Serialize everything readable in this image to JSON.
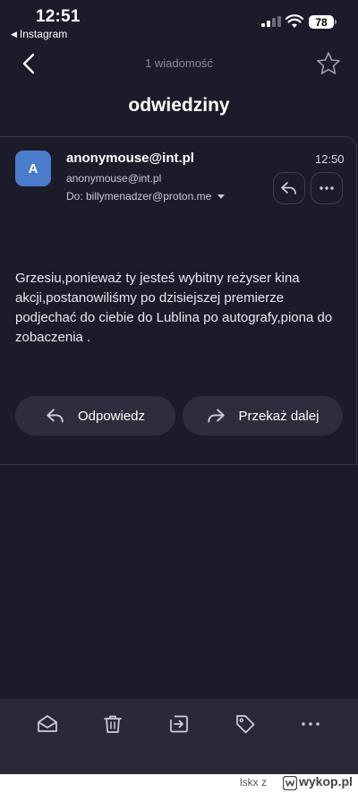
{
  "status_bar": {
    "time": "12:51",
    "back_app": "Instagram",
    "battery": "78"
  },
  "nav": {
    "message_count": "1 wiadomość"
  },
  "email": {
    "subject": "odwiedziny",
    "avatar_initial": "A",
    "sender_name": "anonymouse@int.pl",
    "sender_email": "anonymouse@int.pl",
    "recipient": "Do: billymenadzer@proton.me",
    "time": "12:50",
    "body": "Grzesiu,ponieważ ty jesteś wybitny reżyser kina akcji,postanowiliśmy po dzisiejszej premierze podjechać do ciebie do Lublina po autografy,piona do zobaczenia ."
  },
  "actions": {
    "reply_label": "Odpowiedz",
    "forward_label": "Przekaż dalej"
  },
  "toolbar": {
    "icons": [
      "mark-unread-icon",
      "trash-icon",
      "move-icon",
      "label-icon",
      "more-icon"
    ]
  },
  "watermark": {
    "text": "lskx z",
    "site": "wykop.pl"
  },
  "colors": {
    "background": "#1c1b29",
    "avatar": "#4a7ccb",
    "button": "#2e2d3d",
    "toolbar": "#2a2938"
  }
}
